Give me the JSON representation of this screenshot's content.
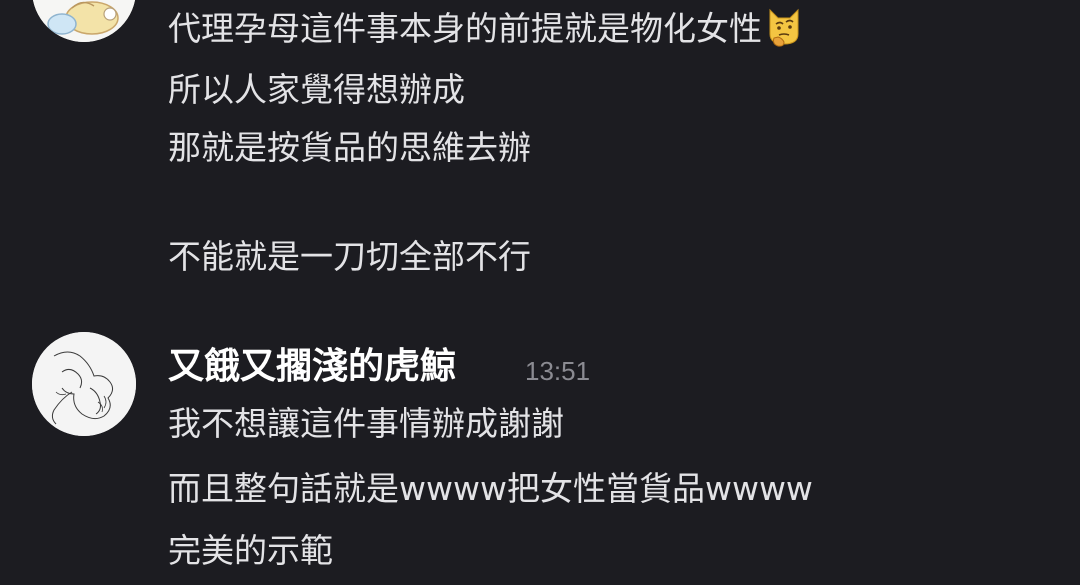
{
  "message_1": {
    "lines": [
      "代理孕母這件事本身的前提就是物化女性",
      "所以人家覺得想辦成",
      "那就是按貨品的思維去辦",
      "不能就是一刀切全部不行"
    ],
    "emoji": "thinking-face-icon"
  },
  "message_2": {
    "sender": "又餓又擱淺的虎鯨",
    "time": "13:51",
    "lines": [
      "我不想讓這件事情辦成謝謝",
      "而且整句話就是wwww把女性當貨品wwww",
      "完美的示範"
    ]
  },
  "colors": {
    "background": "#1c1c21",
    "text": "#e3e3e6",
    "sender": "#ffffff",
    "timestamp": "#8b8b92",
    "avatar_bg": "#f4f4f4"
  }
}
